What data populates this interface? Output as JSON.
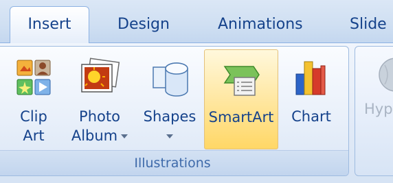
{
  "tabs": [
    {
      "label": "Insert",
      "active": true
    },
    {
      "label": "Design",
      "active": false
    },
    {
      "label": "Animations",
      "active": false
    },
    {
      "label": "Slide",
      "active": false
    }
  ],
  "groups": {
    "illustrations": {
      "label": "Illustrations",
      "buttons": [
        {
          "line1": "Clip",
          "line2": "Art",
          "icon": "clip-art-icon"
        },
        {
          "line1": "Photo",
          "line2": "Album",
          "icon": "photo-album-icon",
          "dropdown": true
        },
        {
          "line1": "Shapes",
          "line2": "",
          "icon": "shapes-icon",
          "dropdown": true
        },
        {
          "line1": "SmartArt",
          "line2": "",
          "icon": "smartart-icon",
          "highlighted": true
        },
        {
          "line1": "Chart",
          "line2": "",
          "icon": "chart-icon"
        }
      ]
    },
    "next": {
      "partial_label": "Hyp",
      "icon": "hyperlink-globe-icon"
    }
  },
  "colors": {
    "text": "#15428b",
    "group_label": "#3e6aaa",
    "highlight_top": "#fff8dc",
    "highlight_bottom": "#ffd766",
    "disabled_text": "#a9b4c3"
  }
}
